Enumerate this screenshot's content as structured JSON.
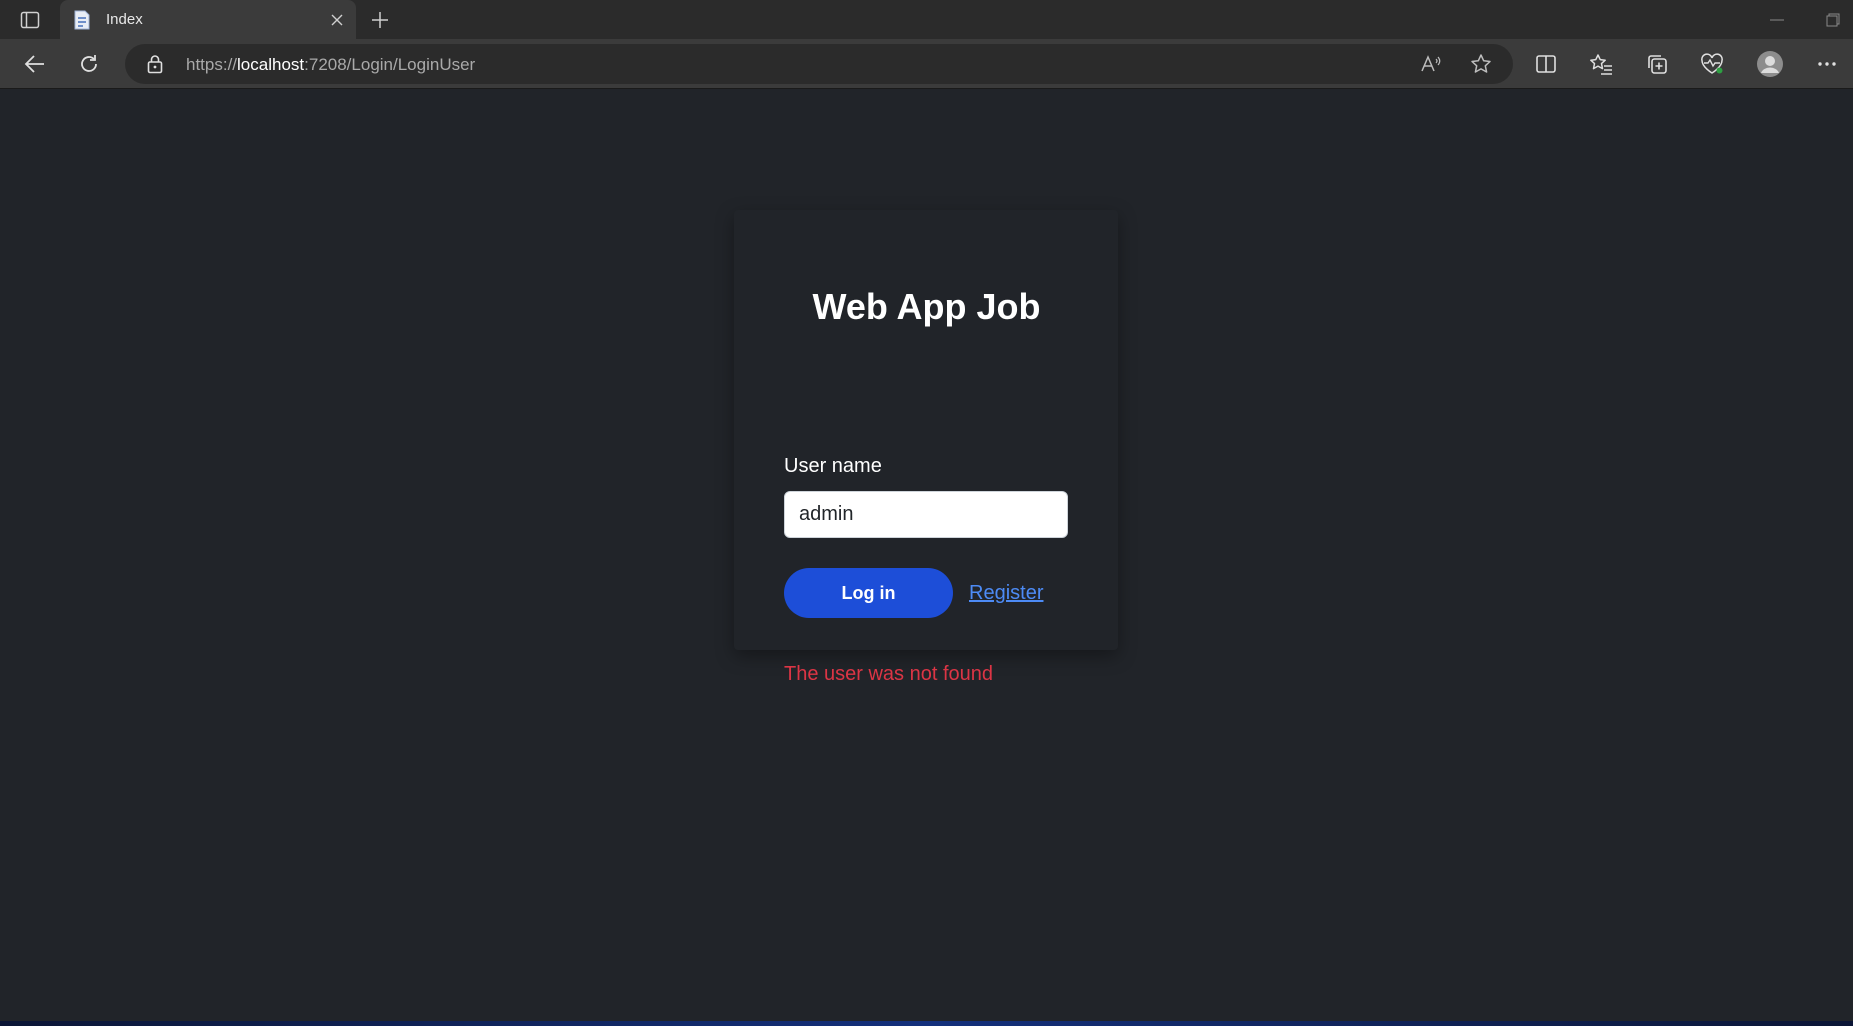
{
  "browser": {
    "tab": {
      "title": "Index",
      "favicon": "page-icon"
    },
    "address": {
      "scheme": "https://",
      "host": "localhost",
      "rest": ":7208/Login/LoginUser"
    },
    "toolbar_icons": [
      "back-icon",
      "refresh-icon",
      "read-aloud-icon",
      "favorite-star-icon",
      "split-screen-icon",
      "favorites-icon",
      "collections-icon",
      "browser-essentials-icon",
      "profile-icon",
      "more-icon"
    ]
  },
  "login": {
    "title": "Web App Job",
    "username_label": "User name",
    "username_value": "admin",
    "login_button": "Log in",
    "register_link": "Register",
    "error": "The user was not found"
  },
  "colors": {
    "page_background": "#212429",
    "primary_button": "#1d4ed8",
    "link": "#4d8bf5",
    "error": "#dc3545"
  }
}
